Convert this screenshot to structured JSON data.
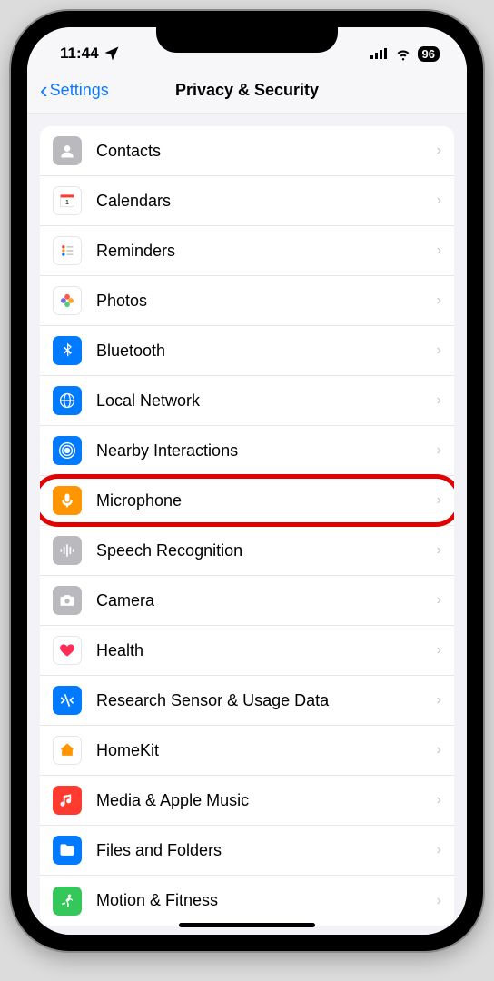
{
  "status": {
    "time": "11:44",
    "battery": "96"
  },
  "nav": {
    "back": "Settings",
    "title": "Privacy & Security"
  },
  "items": [
    {
      "label": "Contacts"
    },
    {
      "label": "Calendars"
    },
    {
      "label": "Reminders"
    },
    {
      "label": "Photos"
    },
    {
      "label": "Bluetooth"
    },
    {
      "label": "Local Network"
    },
    {
      "label": "Nearby Interactions"
    },
    {
      "label": "Microphone",
      "highlighted": true
    },
    {
      "label": "Speech Recognition"
    },
    {
      "label": "Camera"
    },
    {
      "label": "Health"
    },
    {
      "label": "Research Sensor & Usage Data"
    },
    {
      "label": "HomeKit"
    },
    {
      "label": "Media & Apple Music"
    },
    {
      "label": "Files and Folders"
    },
    {
      "label": "Motion & Fitness"
    }
  ],
  "highlighted_item": "Microphone"
}
